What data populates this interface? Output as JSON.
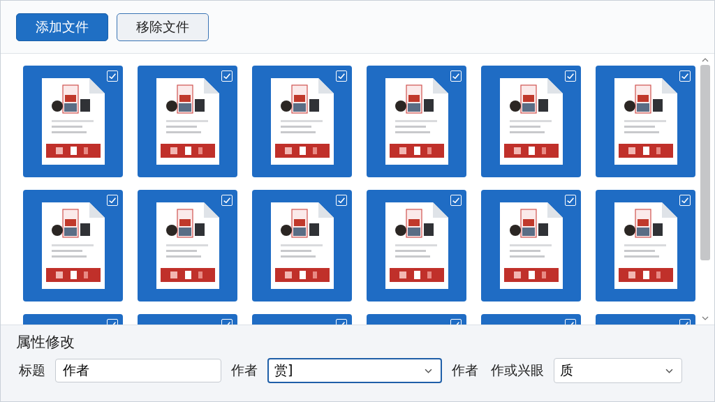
{
  "toolbar": {
    "buttons": [
      {
        "label": "添加文件",
        "kind": "primary"
      },
      {
        "label": "移除文件",
        "kind": "secondary"
      }
    ]
  },
  "files": [
    {
      "selected": true,
      "checked": true
    },
    {
      "selected": true,
      "checked": true
    },
    {
      "selected": true,
      "checked": true
    },
    {
      "selected": true,
      "checked": true
    },
    {
      "selected": true,
      "checked": true
    },
    {
      "selected": true,
      "checked": true
    },
    {
      "selected": true,
      "checked": true
    },
    {
      "selected": true,
      "checked": true
    },
    {
      "selected": true,
      "checked": true
    },
    {
      "selected": true,
      "checked": true
    },
    {
      "selected": true,
      "checked": true
    },
    {
      "selected": true,
      "checked": true
    },
    {
      "selected": true,
      "checked": true
    },
    {
      "selected": true,
      "checked": true
    },
    {
      "selected": true,
      "checked": true
    },
    {
      "selected": true,
      "checked": true
    },
    {
      "selected": true,
      "checked": true
    },
    {
      "selected": true,
      "checked": true
    }
  ],
  "properties": {
    "title": "属性修改",
    "fields": [
      {
        "label": "标题",
        "kind": "text",
        "value": "作者"
      },
      {
        "label": "作者",
        "kind": "select",
        "value": "赏]",
        "focused": true
      },
      {
        "label": "作者",
        "kind": "label"
      },
      {
        "label": "作或兴眼",
        "kind": "select",
        "value": "质",
        "focused": false
      }
    ]
  }
}
